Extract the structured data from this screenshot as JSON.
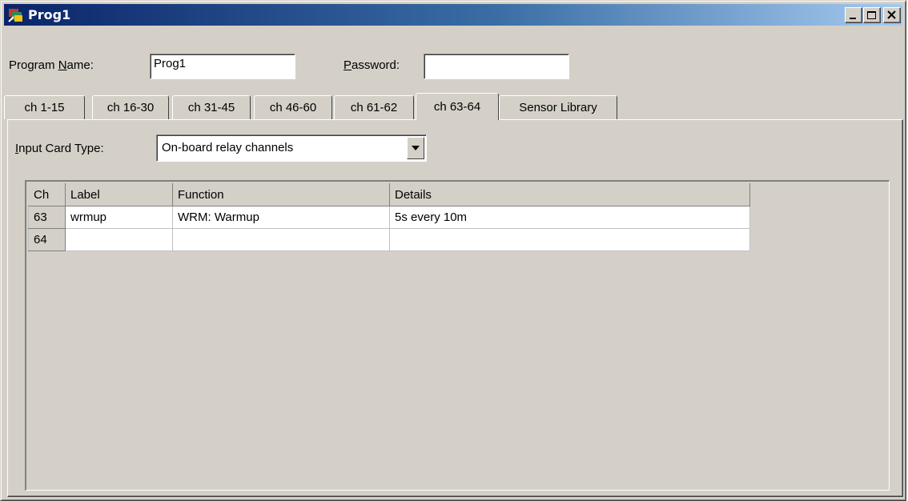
{
  "window": {
    "title": "Prog1"
  },
  "form": {
    "program_name_label_pre": "Program ",
    "program_name_label_u": "N",
    "program_name_label_post": "ame:",
    "program_name_value": "Prog1",
    "password_label_u": "P",
    "password_label_post": "assword:",
    "password_value": "",
    "input_card_label_u": "I",
    "input_card_label_post": "nput Card Type:",
    "input_card_value": "On-board relay channels"
  },
  "tabs": [
    {
      "label": "ch 1-15"
    },
    {
      "label": "ch 16-30"
    },
    {
      "label": "ch 31-45"
    },
    {
      "label": "ch 46-60"
    },
    {
      "label": "ch 61-62"
    },
    {
      "label": "ch 63-64",
      "active": true
    },
    {
      "label": "Sensor Library"
    }
  ],
  "grid": {
    "columns": [
      "Ch",
      "Label",
      "Function",
      "Details"
    ],
    "rows": [
      {
        "ch": "63",
        "label": "wrmup",
        "function": "WRM:  Warmup",
        "details": "5s every 10m"
      },
      {
        "ch": "64",
        "label": "",
        "function": "",
        "details": ""
      }
    ]
  },
  "colors": {
    "titlebar_start": "#0a246a",
    "titlebar_end": "#a6caf0",
    "face": "#d4d0c8"
  }
}
